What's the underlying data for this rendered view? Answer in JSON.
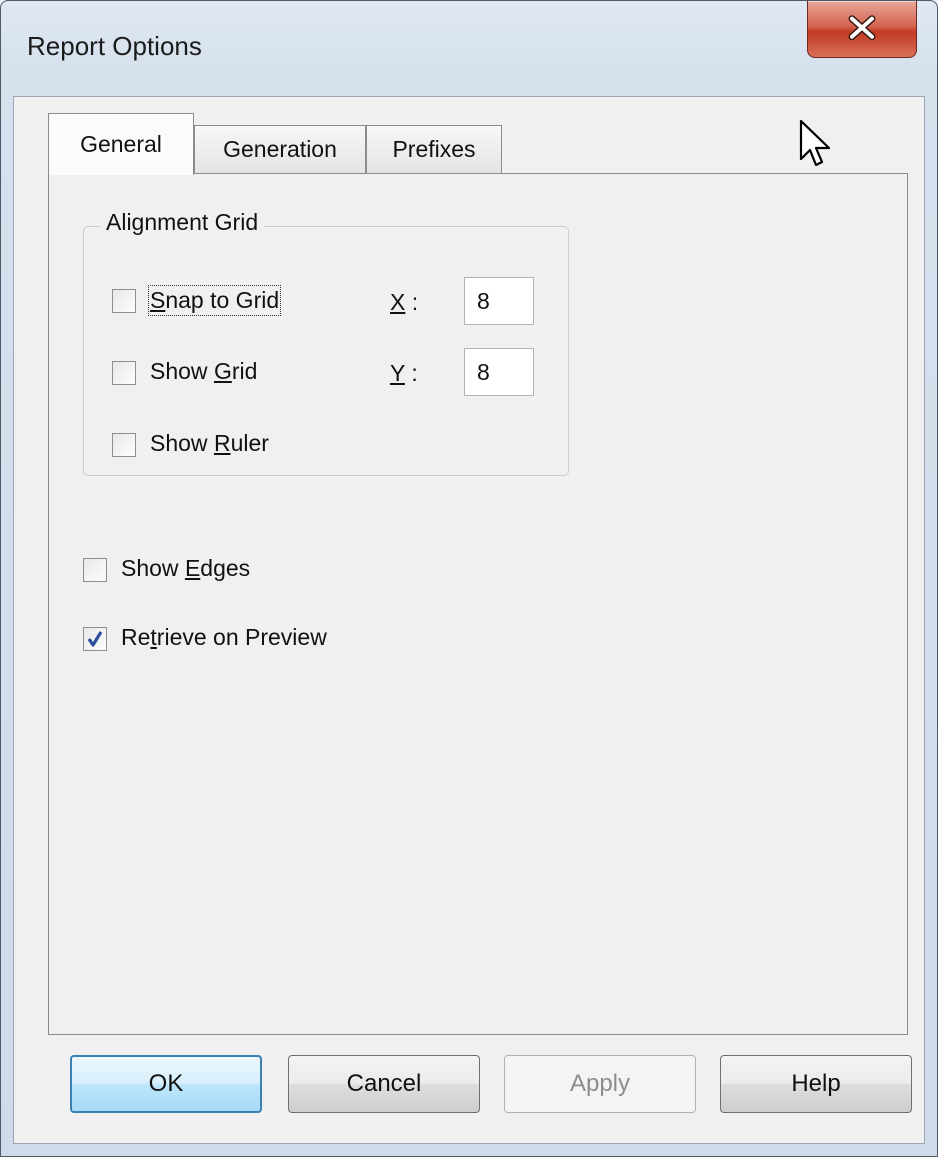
{
  "window": {
    "title": "Report Options",
    "close_icon": "close-icon"
  },
  "tabs": [
    {
      "label": "General",
      "active": true
    },
    {
      "label": "Generation",
      "active": false
    },
    {
      "label": "Prefixes",
      "active": false
    }
  ],
  "alignment_grid": {
    "title": "Alignment Grid",
    "snap_to_grid": {
      "label_pre": "",
      "mnemonic": "S",
      "label_post": "nap to Grid",
      "checked": false
    },
    "show_grid": {
      "label_pre": "Show ",
      "mnemonic": "G",
      "label_post": "rid",
      "checked": false
    },
    "show_ruler": {
      "label_pre": "Show ",
      "mnemonic": "R",
      "label_post": "uler",
      "checked": false
    },
    "x": {
      "mnemonic": "X",
      "suffix": " :",
      "value": "8"
    },
    "y": {
      "mnemonic": "Y",
      "suffix": " :",
      "value": "8"
    }
  },
  "options": {
    "show_edges": {
      "label_pre": "Show ",
      "mnemonic": "E",
      "label_post": "dges",
      "checked": false
    },
    "retrieve_on_preview": {
      "label_pre": "Re",
      "mnemonic": "t",
      "label_post": "rieve on Preview",
      "checked": true
    }
  },
  "buttons": {
    "ok": "OK",
    "cancel": "Cancel",
    "apply": "Apply",
    "help": "Help"
  },
  "colors": {
    "close_button": "#c13a22",
    "default_button_border": "#3c7fb1",
    "check_mark": "#2a4f9c"
  }
}
